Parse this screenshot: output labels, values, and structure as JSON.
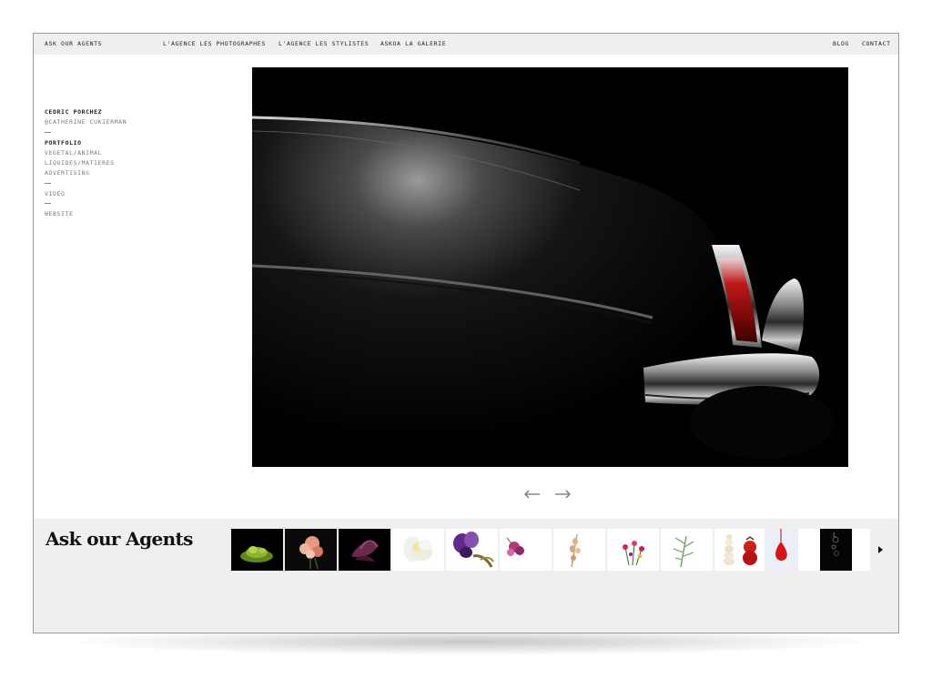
{
  "header": {
    "brand": "ASK OUR AGENTS",
    "nav": [
      {
        "label": "L'AGENCE LES PHOTOGRAPHES"
      },
      {
        "label": "L'AGENCE LES STYLISTES"
      },
      {
        "label": "ASKOA LA GALERIE"
      }
    ],
    "right_nav": [
      {
        "label": "BLOG"
      },
      {
        "label": "CONTACT"
      }
    ]
  },
  "sidebar": {
    "photographer": "CEDRIC PORCHEZ",
    "agent": "@CATHERINE CUKIERMAN",
    "portfolio_heading": "PORTFOLIO",
    "categories": [
      {
        "label": "VEGETAL/ANIMAL"
      },
      {
        "label": "LIQUIDES/MATIERES"
      },
      {
        "label": "ADVERTISING"
      }
    ],
    "video": "VIDEO",
    "website": "WEBSITE"
  },
  "main_image": {
    "subject": "black classic car rear fender with chrome bumper and red tail light"
  },
  "gallery_nav": {
    "prev_icon": "arrow-left-icon",
    "next_icon": "arrow-right-icon"
  },
  "footer": {
    "logo_text": "Ask our Agents",
    "next_icon": "triangle-right-icon"
  },
  "colors": {
    "topbar_bg": "#efefef",
    "footer_bg": "#efefef",
    "window_border": "#9a9a9a",
    "text_dark": "#222222",
    "text_muted": "#7a7a7a"
  }
}
